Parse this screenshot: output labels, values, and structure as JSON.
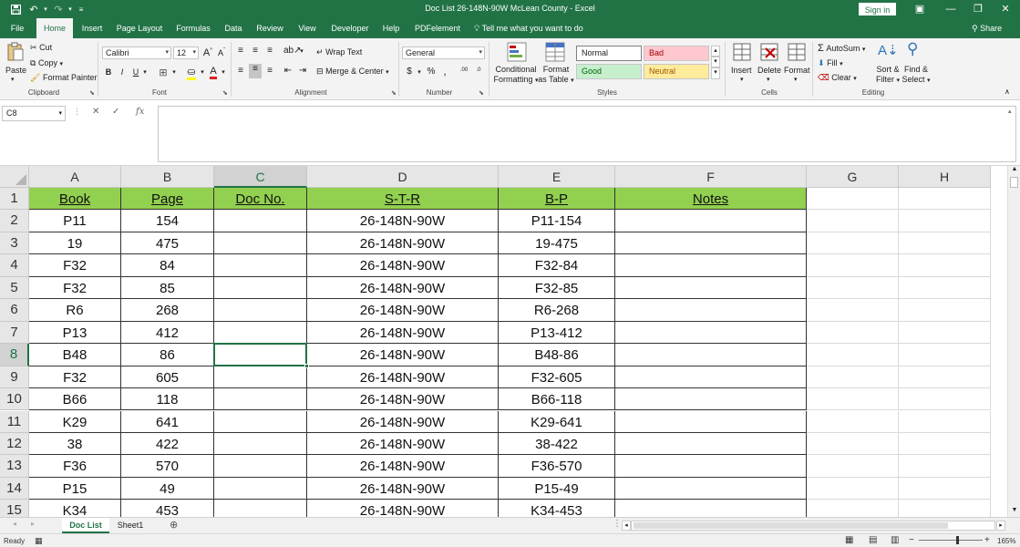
{
  "window": {
    "title": "Doc List 26-148N-90W McLean County  -  Excel",
    "sign_in": "Sign in",
    "share": "Share"
  },
  "ribbon_tabs": [
    "File",
    "Home",
    "Insert",
    "Page Layout",
    "Formulas",
    "Data",
    "Review",
    "View",
    "Developer",
    "Help",
    "PDFelement"
  ],
  "active_tab": "Home",
  "tell_me": "Tell me what you want to do",
  "clipboard": {
    "paste": "Paste",
    "cut": "Cut",
    "copy": "Copy",
    "format_painter": "Format Painter",
    "group_label": "Clipboard"
  },
  "font": {
    "family": "Calibri",
    "size": "12",
    "bold": "B",
    "italic": "I",
    "underline": "U",
    "grow": "A",
    "shrink": "A",
    "group_label": "Font"
  },
  "alignment": {
    "wrap_text": "Wrap Text",
    "merge_center": "Merge & Center",
    "group_label": "Alignment"
  },
  "number": {
    "format": "General",
    "currency": "$",
    "percent": "%",
    "comma": ",",
    "increase_decimal": ".00",
    "decrease_decimal": ".0",
    "group_label": "Number"
  },
  "styles": {
    "conditional_formatting": "Conditional Formatting",
    "format_as_table": "Format as Table",
    "normal": "Normal",
    "bad": "Bad",
    "good": "Good",
    "neutral": "Neutral",
    "group_label": "Styles"
  },
  "cells": {
    "insert": "Insert",
    "delete": "Delete",
    "format": "Format",
    "group_label": "Cells"
  },
  "editing": {
    "autosum": "AutoSum",
    "fill": "Fill",
    "clear": "Clear",
    "sort_filter": "Sort & Filter",
    "find_select": "Find & Select",
    "group_label": "Editing"
  },
  "formula_bar": {
    "name_box": "C8",
    "fx": "fx",
    "content": ""
  },
  "grid": {
    "columns": [
      "A",
      "B",
      "C",
      "D",
      "E",
      "F",
      "G",
      "H"
    ],
    "header_row": [
      "Book",
      "Page",
      "Doc No.",
      "S-T-R",
      "B-P",
      "Notes"
    ],
    "rows": [
      [
        "P11",
        "154",
        "",
        "26-148N-90W",
        "P11-154",
        ""
      ],
      [
        "19",
        "475",
        "",
        "26-148N-90W",
        "19-475",
        ""
      ],
      [
        "F32",
        "84",
        "",
        "26-148N-90W",
        "F32-84",
        ""
      ],
      [
        "F32",
        "85",
        "",
        "26-148N-90W",
        "F32-85",
        ""
      ],
      [
        "R6",
        "268",
        "",
        "26-148N-90W",
        "R6-268",
        ""
      ],
      [
        "P13",
        "412",
        "",
        "26-148N-90W",
        "P13-412",
        ""
      ],
      [
        "B48",
        "86",
        "",
        "26-148N-90W",
        "B48-86",
        ""
      ],
      [
        "F32",
        "605",
        "",
        "26-148N-90W",
        "F32-605",
        ""
      ],
      [
        "B66",
        "118",
        "",
        "26-148N-90W",
        "B66-118",
        ""
      ],
      [
        "K29",
        "641",
        "",
        "26-148N-90W",
        "K29-641",
        ""
      ],
      [
        "38",
        "422",
        "",
        "26-148N-90W",
        "38-422",
        ""
      ],
      [
        "F36",
        "570",
        "",
        "26-148N-90W",
        "F36-570",
        ""
      ],
      [
        "P15",
        "49",
        "",
        "26-148N-90W",
        "P15-49",
        ""
      ],
      [
        "K34",
        "453",
        "",
        "26-148N-90W",
        "K34-453",
        ""
      ]
    ],
    "row_numbers": [
      "1",
      "2",
      "3",
      "4",
      "5",
      "6",
      "7",
      "8",
      "9",
      "10",
      "11",
      "12",
      "13",
      "14",
      "15"
    ],
    "selected_cell": "C8",
    "header_fill": "#92d050",
    "accent": "#217346"
  },
  "sheets": {
    "tabs": [
      "Doc List",
      "Sheet1"
    ],
    "active": "Doc List"
  },
  "status": {
    "ready": "Ready",
    "zoom": "165%"
  }
}
